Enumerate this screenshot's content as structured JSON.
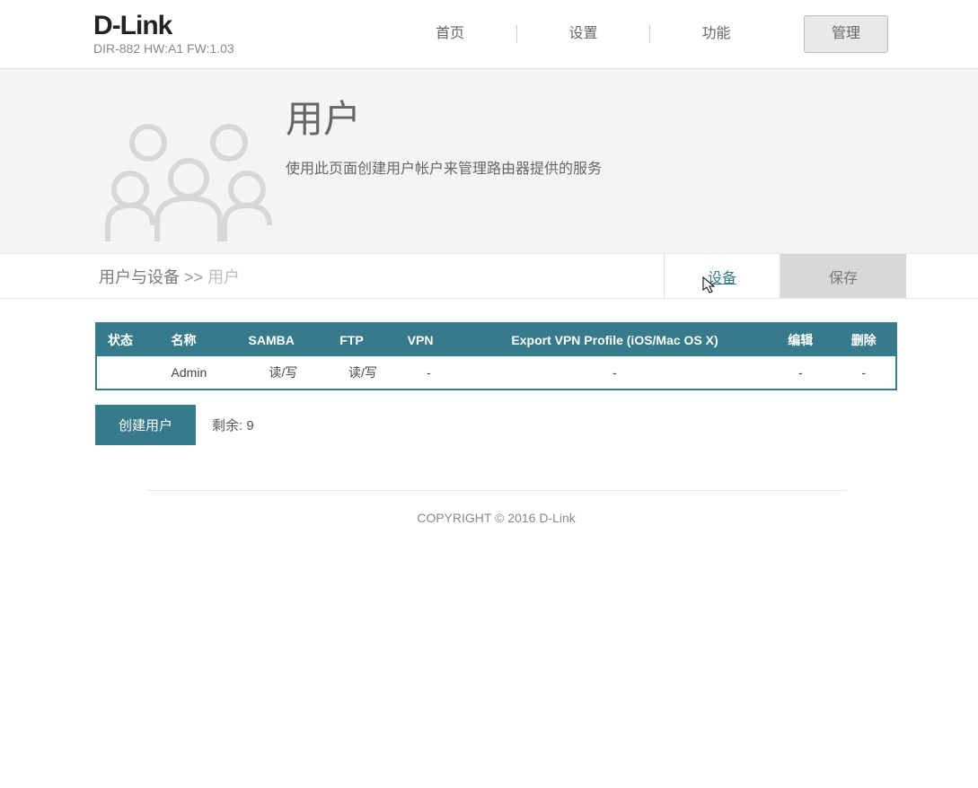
{
  "brand": {
    "logo": "D-Link",
    "model": "DIR-882 HW:A1 FW:1.03"
  },
  "nav": {
    "home": "首页",
    "settings": "设置",
    "features": "功能",
    "manage": "管理"
  },
  "hero": {
    "title": "用户",
    "desc": "使用此页面创建用户帐户来管理路由器提供的服务"
  },
  "breadcrumb": {
    "root": "用户与设备",
    "sep": ">>",
    "current": "用户"
  },
  "actions": {
    "restore": "设备",
    "save": "保存"
  },
  "table": {
    "headers": {
      "status": "状态",
      "name": "名称",
      "samba": "SAMBA",
      "ftp": "FTP",
      "vpn": "VPN",
      "export": "Export VPN Profile (iOS/Mac OS X)",
      "edit": "编辑",
      "delete": "删除"
    },
    "rows": [
      {
        "status": "",
        "name": "Admin",
        "samba": "读/写",
        "ftp": "读/写",
        "vpn": "-",
        "export": "-",
        "edit": "-",
        "delete": "-"
      }
    ]
  },
  "create": {
    "label": "创建用户",
    "remaining": "剩余: 9"
  },
  "footer": {
    "copyright": "COPYRIGHT © 2016 D-Link"
  }
}
